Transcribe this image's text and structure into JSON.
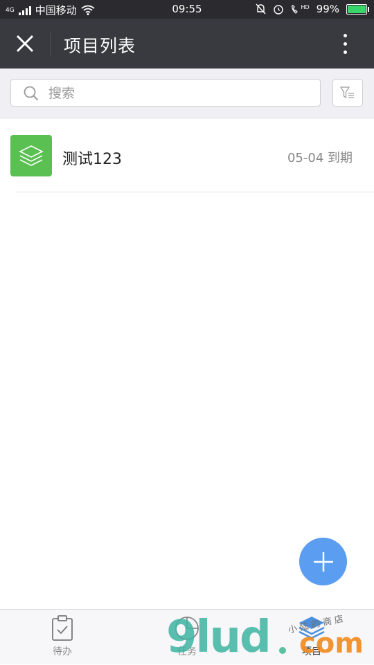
{
  "status_bar": {
    "network": "4G",
    "carrier": "中国移动",
    "time": "09:55",
    "battery_text": "99%",
    "hd_text": "HD",
    "battery_level": 0.99
  },
  "header": {
    "title": "项目列表"
  },
  "search": {
    "placeholder": "搜索",
    "value": ""
  },
  "projects": [
    {
      "name": "测试123",
      "due": "05-04 到期"
    }
  ],
  "bottom_nav": [
    {
      "label": "待办",
      "icon": "clipboard-check-icon"
    },
    {
      "label": "任务",
      "icon": "pie-chart-icon"
    },
    {
      "label": "项目",
      "icon": "layers-icon"
    }
  ],
  "watermark": {
    "main": "9lud",
    "com": "com",
    "sub": "小陆的商店"
  },
  "colors": {
    "status_bar": "#2b2b2f",
    "header": "#393a3f",
    "project_icon": "#5ac052",
    "fab": "#5b9df0",
    "background": "#efeff4"
  }
}
